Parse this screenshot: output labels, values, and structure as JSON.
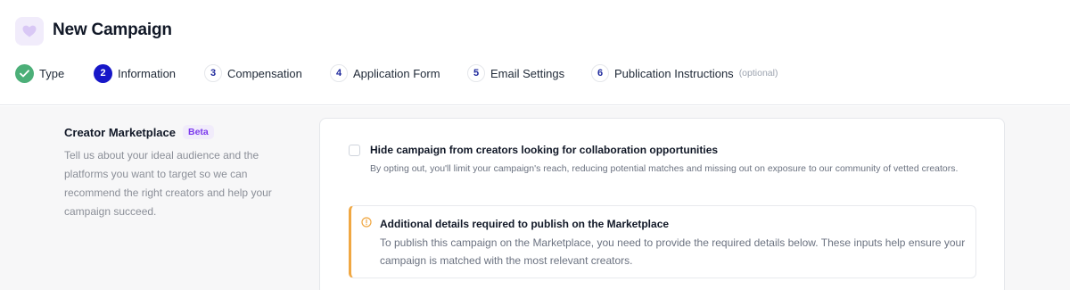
{
  "header": {
    "title": "New Campaign",
    "logo_icon": "heart-icon",
    "accent_color": "#1717c8"
  },
  "stepper": {
    "steps": [
      {
        "number": "1",
        "label": "Type",
        "state": "complete",
        "icon": "check-icon"
      },
      {
        "number": "2",
        "label": "Information",
        "state": "current"
      },
      {
        "number": "3",
        "label": "Compensation",
        "state": "upcoming"
      },
      {
        "number": "4",
        "label": "Application Form",
        "state": "upcoming"
      },
      {
        "number": "5",
        "label": "Email Settings",
        "state": "upcoming"
      },
      {
        "number": "6",
        "label": "Publication Instructions",
        "state": "upcoming",
        "optional_label": "(optional)"
      }
    ]
  },
  "section": {
    "title": "Creator Marketplace",
    "badge": "Beta",
    "description": "Tell us about your ideal audience and the platforms you want to target so we can recommend the right creators and help your campaign succeed."
  },
  "card": {
    "checkbox": {
      "label": "Hide campaign from creators looking for collaboration opportunities",
      "description": "By opting out, you'll limit your campaign's reach, reducing potential matches and missing out on exposure to our community of vetted creators.",
      "checked": false
    },
    "alert": {
      "icon": "warning-circle-icon",
      "title": "Additional details required to publish on the Marketplace",
      "text": "To publish this campaign on the Marketplace, you need to provide the required details below. These inputs help ensure your campaign is matched with the most relevant creators.",
      "accent_color": "#f0a742"
    }
  }
}
